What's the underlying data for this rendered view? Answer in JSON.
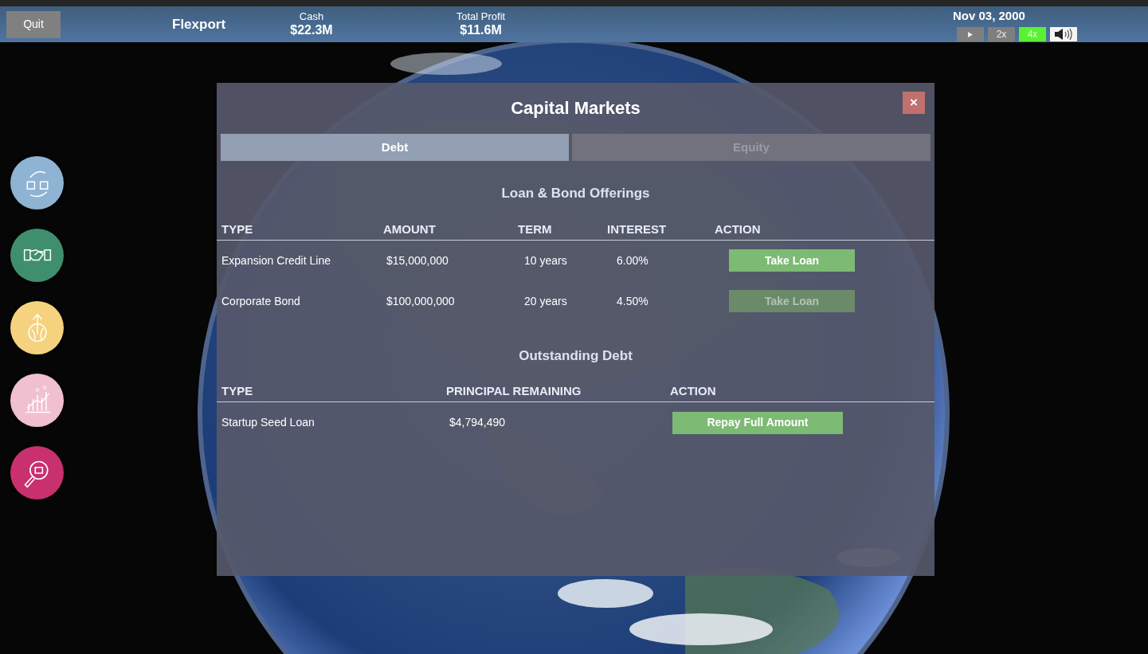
{
  "top_bar": {
    "quit_button": "Quit",
    "company": "Flexport",
    "stats": [
      {
        "label": "Cash",
        "value": "$22.3M"
      },
      {
        "label": "Total Profit",
        "value": "$11.6M"
      }
    ],
    "date": "Nov 03, 2000",
    "speeds": [
      {
        "kind": "play",
        "selected": false
      },
      {
        "kind": "text",
        "label": "2x",
        "selected": false
      },
      {
        "kind": "text",
        "label": "4x",
        "selected": true
      }
    ]
  },
  "side_buttons": [
    {
      "kind": "exchange",
      "color": "#8fb3d2"
    },
    {
      "kind": "handshake",
      "color": "#3f8f6e"
    },
    {
      "kind": "globe",
      "color": "#f5d27e"
    },
    {
      "kind": "chart",
      "color": "#f0bfd0"
    },
    {
      "kind": "search",
      "color": "#c8306e"
    }
  ],
  "dialog": {
    "title": "Capital Markets",
    "close": "×",
    "tabs": [
      {
        "label": "Debt",
        "selected": true
      },
      {
        "label": "Equity",
        "selected": false
      }
    ],
    "offerings": {
      "title": "Loan & Bond Offerings",
      "columns": [
        "TYPE",
        "AMOUNT",
        "TERM",
        "INTEREST",
        "ACTION"
      ],
      "rows": [
        {
          "type": "Expansion Credit Line",
          "amount": "$15,000,000",
          "term": "10 years",
          "interest": "6.00%",
          "action": "Take Loan",
          "disabled": false
        },
        {
          "type": "Corporate Bond",
          "amount": "$100,000,000",
          "term": "20 years",
          "interest": "4.50%",
          "action": "Take Loan",
          "disabled": true
        }
      ]
    },
    "outstanding": {
      "title": "Outstanding Debt",
      "columns": [
        "TYPE",
        "PRINCIPAL REMAINING",
        "ACTION"
      ],
      "rows": [
        {
          "type": "Startup Seed Loan",
          "principal": "$4,794,490",
          "action": "Repay Full Amount",
          "disabled": false
        }
      ]
    }
  }
}
